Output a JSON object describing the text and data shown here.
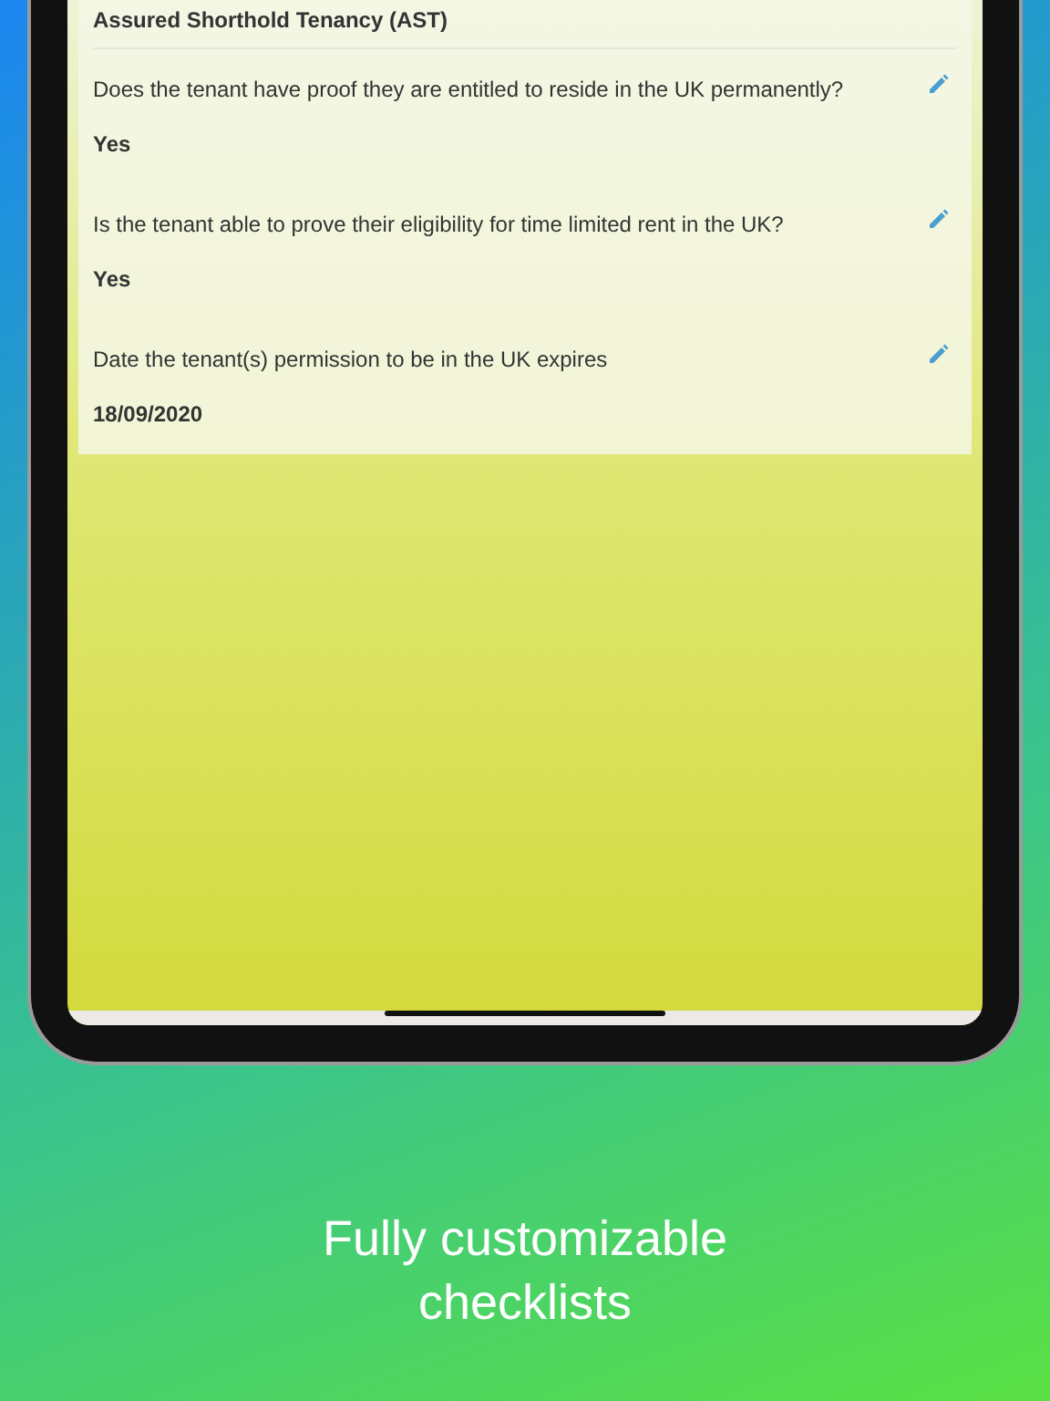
{
  "section_title": "Assured Shorthold Tenancy (AST)",
  "questions": [
    {
      "question": "Does the tenant have proof they are entitled to reside in the UK permanently?",
      "answer": "Yes"
    },
    {
      "question": "Is the tenant able to prove their eligibility for time limited rent in the UK?",
      "answer": "Yes"
    },
    {
      "question": "Date the tenant(s) permission to be in the UK expires",
      "answer": "18/09/2020"
    }
  ],
  "caption": "Fully customizable checklists"
}
